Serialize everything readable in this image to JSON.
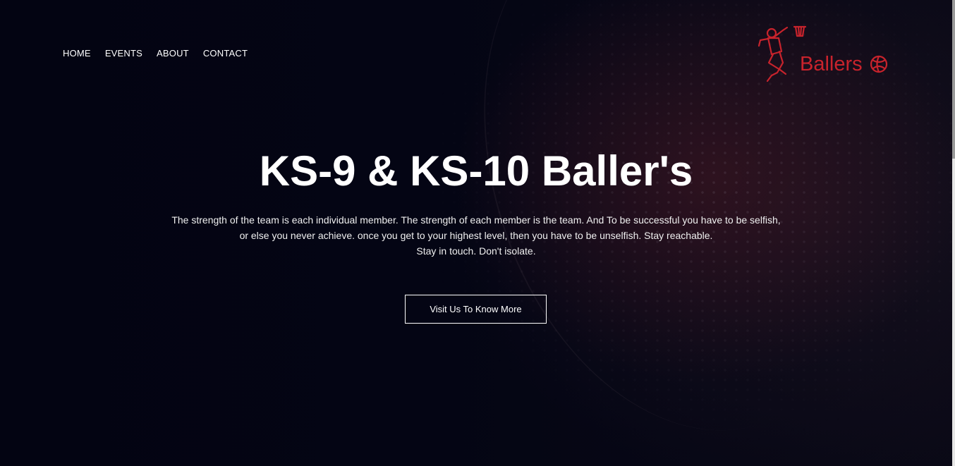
{
  "nav": {
    "items": [
      "HOME",
      "EVENTS",
      "ABOUT",
      "CONTACT"
    ]
  },
  "logo": {
    "text": "Ballers",
    "icon": "basketball-player-icon",
    "color": "#c8232c"
  },
  "hero": {
    "title": "KS-9 & KS-10 Baller's",
    "lines": [
      "The strength of the team is each individual member. The strength of each member is the team. And To be successful you have to be selfish,",
      "or else you never achieve. once you get to your highest level, then you have to be unselfish. Stay reachable.",
      "Stay in touch. Don't isolate."
    ],
    "cta_label": "Visit Us To Know More"
  }
}
